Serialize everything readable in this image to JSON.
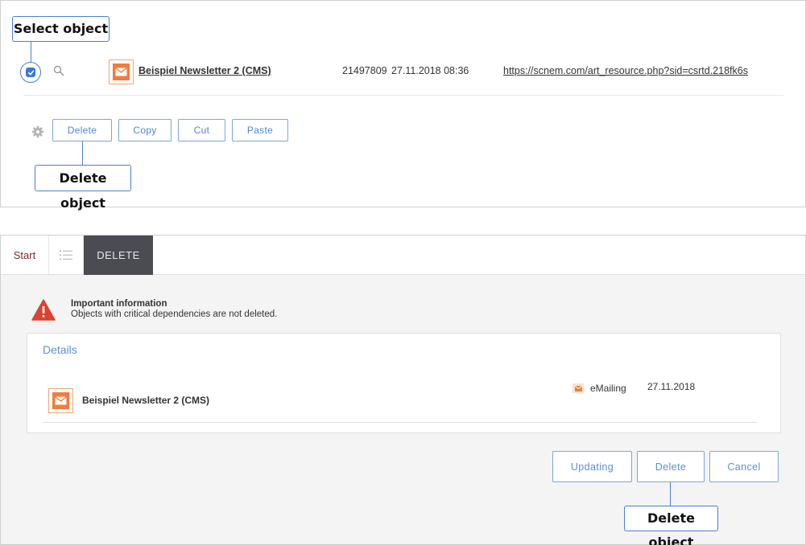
{
  "top_panel": {
    "callout_select": "Select object",
    "callout_delete": "Delete object",
    "row": {
      "title": "Beispiel Newsletter 2 (CMS)",
      "id": "21497809",
      "date": "27.11.2018 08:36",
      "url": "https://scnem.com/art_resource.php?sid=csrtd.218fk6s"
    },
    "actions": [
      "Delete",
      "Copy",
      "Cut",
      "Paste"
    ]
  },
  "bottom_panel": {
    "tabs": {
      "start": "Start",
      "delete": "DELETE"
    },
    "info": {
      "title": "Important information",
      "text": "Objects with critical dependencies are not deleted."
    },
    "details": {
      "heading": "Details",
      "item_title": "Beispiel Newsletter 2 (CMS)",
      "item_type": "eMailing",
      "item_date": "27.11.2018"
    },
    "buttons": {
      "updating": "Updating",
      "delete": "Delete",
      "cancel": "Cancel"
    },
    "callout_delete": "Delete object"
  },
  "colors": {
    "accent_blue": "#4a7fd4",
    "mail_orange": "#f07d3b",
    "warning_red": "#d9432f",
    "tab_active_bg": "#4a4c52"
  },
  "icons": [
    "checkbox-icon",
    "search-icon",
    "mail-icon",
    "gear-icon",
    "list-icon",
    "warning-icon"
  ]
}
